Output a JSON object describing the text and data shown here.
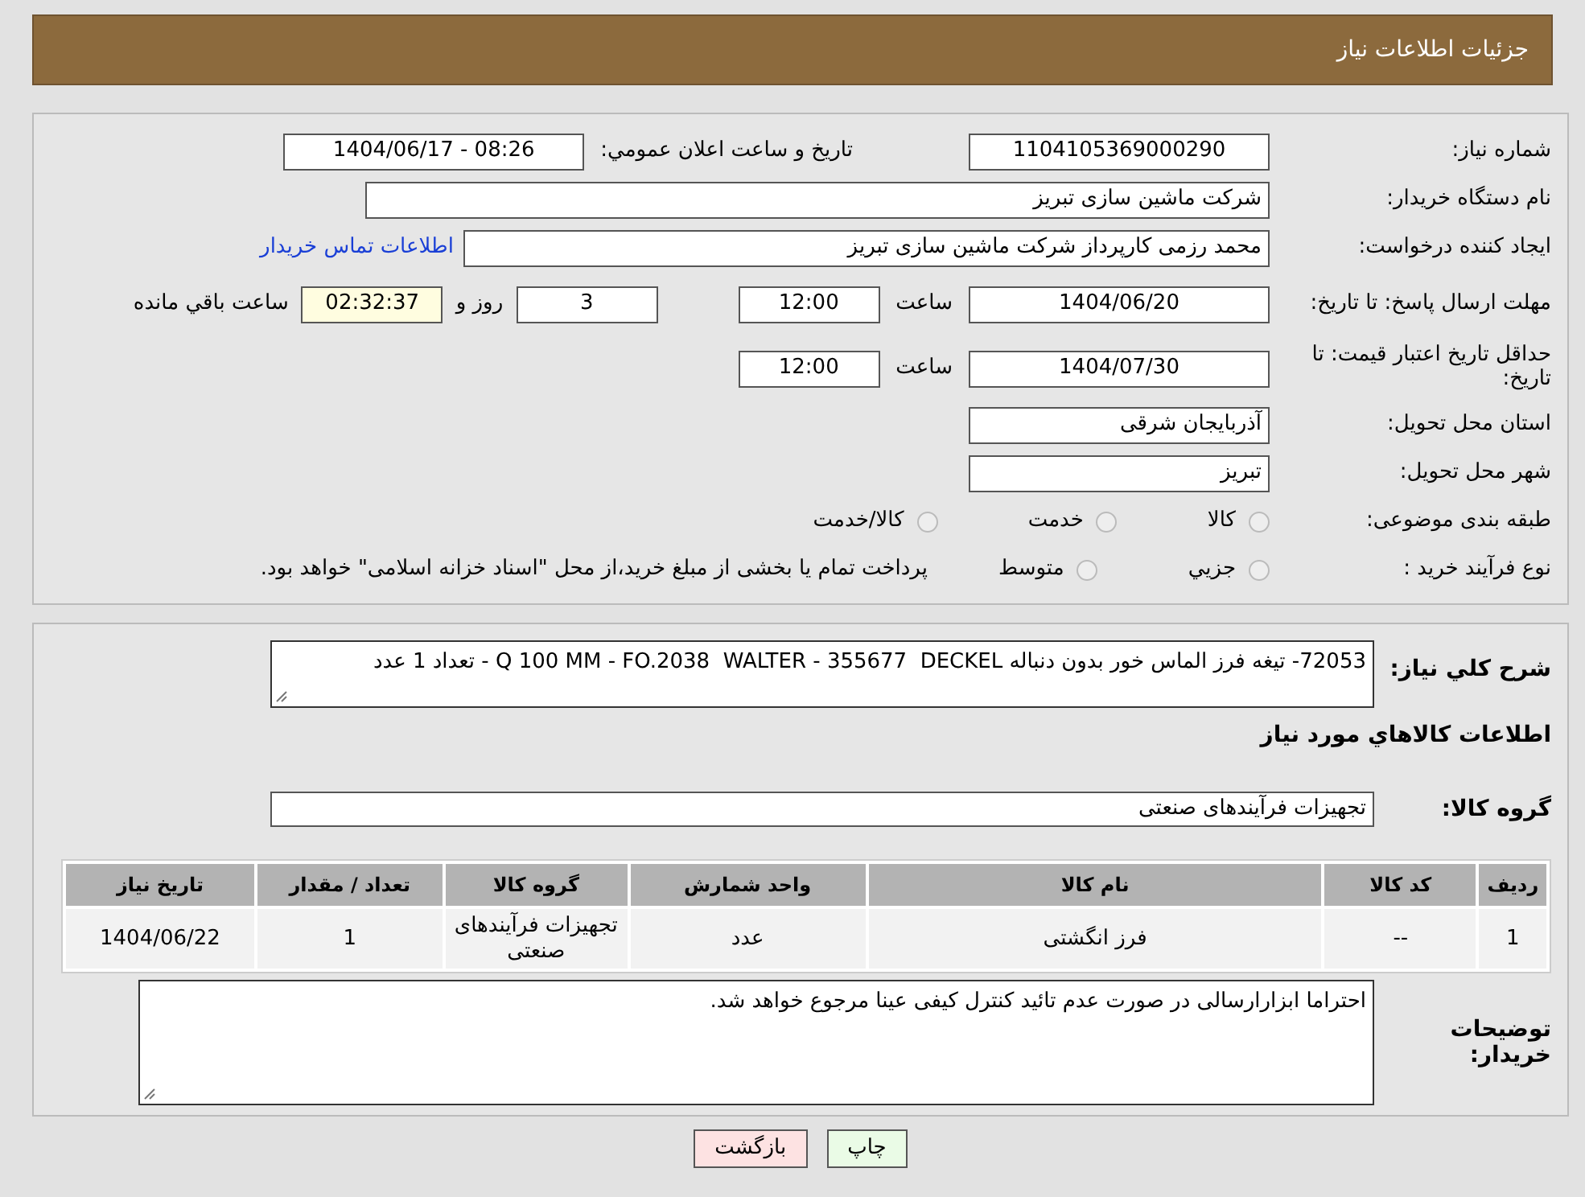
{
  "header": {
    "title": "جزئیات اطلاعات نیاز"
  },
  "need_number": {
    "label": "شماره نیاز:",
    "value": "1104105369000290"
  },
  "announce": {
    "label": "تاریخ و ساعت اعلان عمومي:",
    "value": "1404/06/17 - 08:26"
  },
  "buyer_org": {
    "label": "نام دستگاه خريدار:",
    "value": "شرکت ماشین سازی تبریز"
  },
  "requester": {
    "label": "ایجاد کننده درخواست:",
    "value": "محمد رزمی کارپرداز شرکت ماشین سازی تبریز",
    "link": "اطلاعات تماس خریدار"
  },
  "reply_deadline": {
    "label": "مهلت ارسال پاسخ: تا تاریخ:",
    "date": "1404/06/20",
    "time_label": "ساعت",
    "time": "12:00",
    "days": "3",
    "days_label": "روز و",
    "remaining": "02:32:37",
    "remaining_label": "ساعت باقي مانده"
  },
  "price_validity": {
    "label": "حداقل تاریخ اعتبار قیمت: تا تاریخ:",
    "date": "1404/07/30",
    "time_label": "ساعت",
    "time": "12:00"
  },
  "province": {
    "label": "استان محل تحویل:",
    "value": "آذربایجان شرقی"
  },
  "city": {
    "label": "شهر محل تحویل:",
    "value": "تبریز"
  },
  "category": {
    "label": "طبقه بندی موضوعی:",
    "options": [
      {
        "label": "کالا",
        "selected": false
      },
      {
        "label": "خدمت",
        "selected": false
      },
      {
        "label": "کالا/خدمت",
        "selected": false
      }
    ]
  },
  "process": {
    "label": "نوع فرآیند خرید :",
    "options": [
      {
        "label": "جزيي",
        "selected": false
      },
      {
        "label": "متوسط",
        "selected": false
      }
    ],
    "note": "پرداخت تمام یا بخشی از مبلغ خرید،از محل \"اسناد خزانه اسلامی\" خواهد بود."
  },
  "description": {
    "label": "شرح کلي نياز:",
    "value": "72053- تیغه فرز الماس خور بدون دنباله Q 100 MM - FO.2038  WALTER - 355677  DECKEL - تعداد 1 عدد"
  },
  "items_heading": "اطلاعات کالاهاي مورد نياز",
  "goods_group": {
    "label": "گروه کالا:",
    "value": "تجهیزات فرآیندهای صنعتی"
  },
  "table": {
    "columns": [
      "ردیف",
      "کد کالا",
      "نام کالا",
      "واحد شمارش",
      "گروه کالا",
      "تعداد / مقدار",
      "تاریخ نیاز"
    ],
    "rows": [
      [
        "1",
        "--",
        "فرز انگشتی",
        "عدد",
        "تجهیزات فرآیندهای صنعتی",
        "1",
        "1404/06/22"
      ]
    ]
  },
  "buyer_notes": {
    "label": "توضیحات خریدار:",
    "value": "احتراما ابزارارسالی در صورت عدم تائید کنترل کیفی عینا مرجوع خواهد شد."
  },
  "buttons": [
    {
      "label": "چاپ",
      "kind": "print"
    },
    {
      "label": "بازگشت",
      "kind": "back"
    }
  ]
}
